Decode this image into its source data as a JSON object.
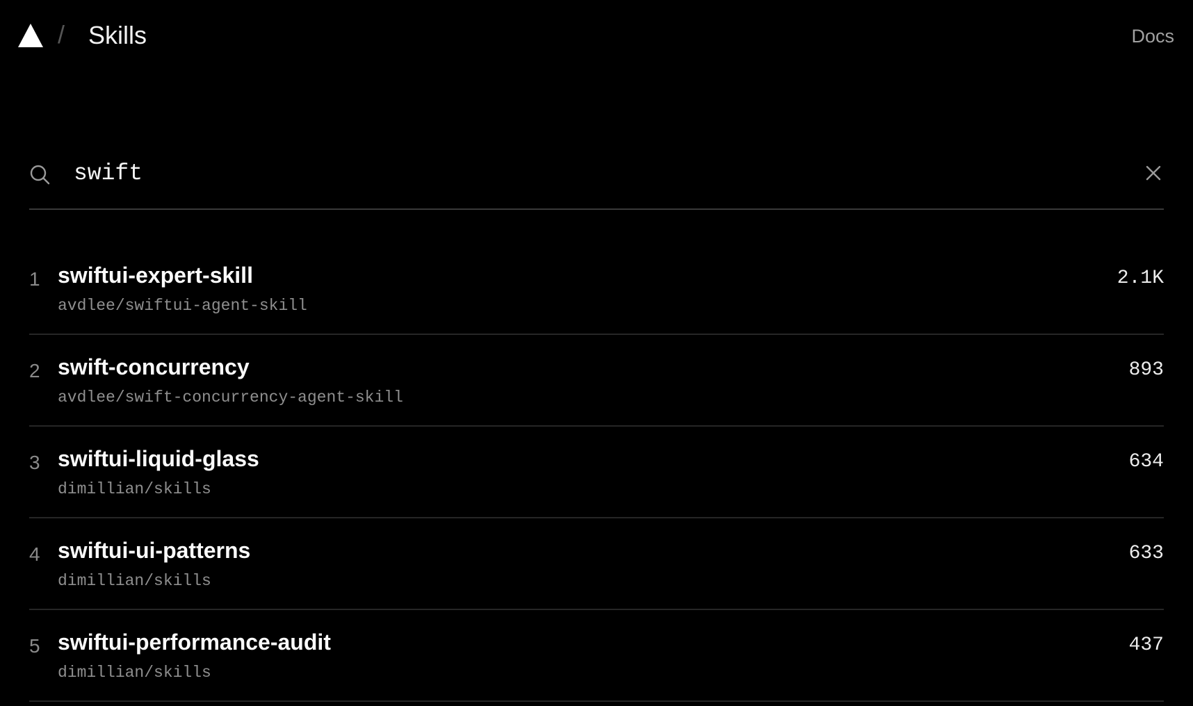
{
  "header": {
    "logo_icon": "triangle-logo-icon",
    "separator": "/",
    "title": "Skills",
    "docs_label": "Docs"
  },
  "search": {
    "icon": "search-icon",
    "value": "swift",
    "clear_icon": "close-icon"
  },
  "results": [
    {
      "rank": "1",
      "name": "swiftui-expert-skill",
      "source": "avdlee/swiftui-agent-skill",
      "installs": "2.1K"
    },
    {
      "rank": "2",
      "name": "swift-concurrency",
      "source": "avdlee/swift-concurrency-agent-skill",
      "installs": "893"
    },
    {
      "rank": "3",
      "name": "swiftui-liquid-glass",
      "source": "dimillian/skills",
      "installs": "634"
    },
    {
      "rank": "4",
      "name": "swiftui-ui-patterns",
      "source": "dimillian/skills",
      "installs": "633"
    },
    {
      "rank": "5",
      "name": "swiftui-performance-audit",
      "source": "dimillian/skills",
      "installs": "437"
    }
  ],
  "colors": {
    "background": "#000000",
    "text_primary": "#fafafa",
    "text_muted": "#8f8f8f",
    "divider": "#262626"
  }
}
